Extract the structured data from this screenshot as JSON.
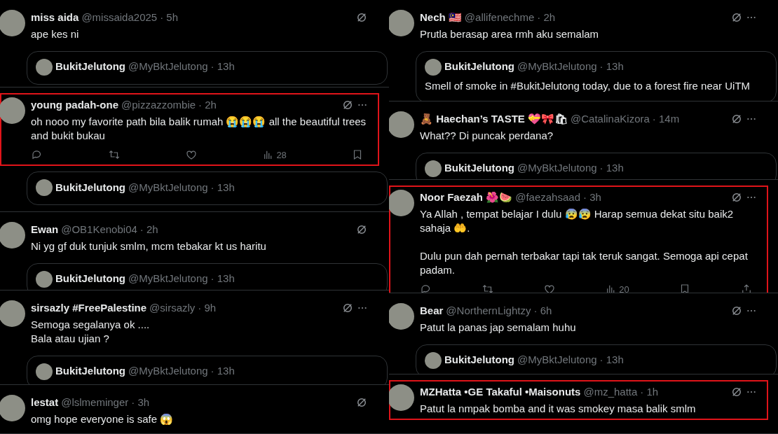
{
  "columns": [
    {
      "tweets": [
        {
          "name": "miss aida",
          "handle": "@missaida2025",
          "time": "· 5h",
          "text": "ape kes ni",
          "highlighted": false,
          "more_menu": false,
          "quote": {
            "name": "BukitJelutong",
            "handle": "@MyBktJelutong",
            "time": "· 13h"
          }
        },
        {
          "name": "young padah-one",
          "handle": "@pizzazzombie",
          "time": "· 2h",
          "text": "oh nooo my favorite path bila balik rumah 😭😭😭 all the beautiful trees and bukit bukau",
          "highlighted": true,
          "more_menu": true,
          "quote": {
            "name": "BukitJelutong",
            "handle": "@MyBktJelutong",
            "time": "· 13h"
          },
          "actions": [
            {
              "kind": "reply"
            },
            {
              "kind": "repost"
            },
            {
              "kind": "like"
            },
            {
              "kind": "views",
              "count": "28"
            },
            {
              "kind": "bookmark"
            }
          ]
        },
        {
          "name": "Ewan",
          "handle": "@OB1Kenobi04",
          "time": "· 2h",
          "text": "Ni yg gf duk tunjuk smlm, mcm tebakar kt us haritu",
          "highlighted": false,
          "more_menu": false,
          "quote": {
            "name": "BukitJelutong",
            "handle": "@MyBktJelutong",
            "time": "· 13h"
          }
        },
        {
          "name": "sirsazly #FreePalestine",
          "handle": "@sirsazly",
          "time": "· 9h",
          "text": "Semoga segalanya ok ....\nBala atau ujian ?",
          "highlighted": false,
          "more_menu": true,
          "quote": {
            "name": "BukitJelutong",
            "handle": "@MyBktJelutong",
            "time": "· 13h"
          }
        },
        {
          "name": "lestat",
          "handle": "@lslmeminger",
          "time": "· 3h",
          "text": "omg hope everyone is safe 😱",
          "highlighted": false,
          "more_menu": false
        }
      ]
    },
    {
      "tweets": [
        {
          "name": "Nech 🇲🇾",
          "handle": "@allifenechme",
          "time": "· 2h",
          "text": "Prutla berasap area rmh aku semalam",
          "highlighted": false,
          "more_menu": true,
          "quote": {
            "name": "BukitJelutong",
            "handle": "@MyBktJelutong",
            "time": "· 13h",
            "text": "Smell of smoke in #BukitJelutong today, due to a forest fire near UiTM"
          }
        },
        {
          "name": "🧸 Haechan’s TASTE 💝🎀🛍",
          "handle": "@CatalinaKizora",
          "time": "· 14m",
          "text": "What?? Di puncak perdana?",
          "highlighted": false,
          "more_menu": true,
          "quote": {
            "name": "BukitJelutong",
            "handle": "@MyBktJelutong",
            "time": "· 13h"
          }
        },
        {
          "name": "Noor Faezah 🌺🍉",
          "handle": "@faezahsaad",
          "time": "· 3h",
          "text": "Ya Allah , tempat belajar I dulu 😰😰 Harap semua dekat situ baik2 sahaja 🤲.\n\nDulu pun dah pernah terbakar tapi tak teruk sangat. Semoga api cepat padam.",
          "highlighted": true,
          "more_menu": true,
          "actions": [
            {
              "kind": "reply"
            },
            {
              "kind": "repost"
            },
            {
              "kind": "like"
            },
            {
              "kind": "views",
              "count": "20"
            },
            {
              "kind": "bookmark"
            },
            {
              "kind": "share"
            }
          ]
        },
        {
          "name": "Bear",
          "handle": "@NorthernLightzy",
          "time": "· 6h",
          "text": "Patut la panas jap semalam huhu",
          "highlighted": false,
          "more_menu": true,
          "quote": {
            "name": "BukitJelutong",
            "handle": "@MyBktJelutong",
            "time": "· 13h"
          }
        },
        {
          "name": "MZHatta •GE Takaful •Maisonuts",
          "handle": "@mz_hatta",
          "time": "· 1h",
          "text": "Patut la nmpak bomba and it was smokey masa balik smlm",
          "highlighted": true,
          "more_menu": true
        }
      ]
    }
  ]
}
